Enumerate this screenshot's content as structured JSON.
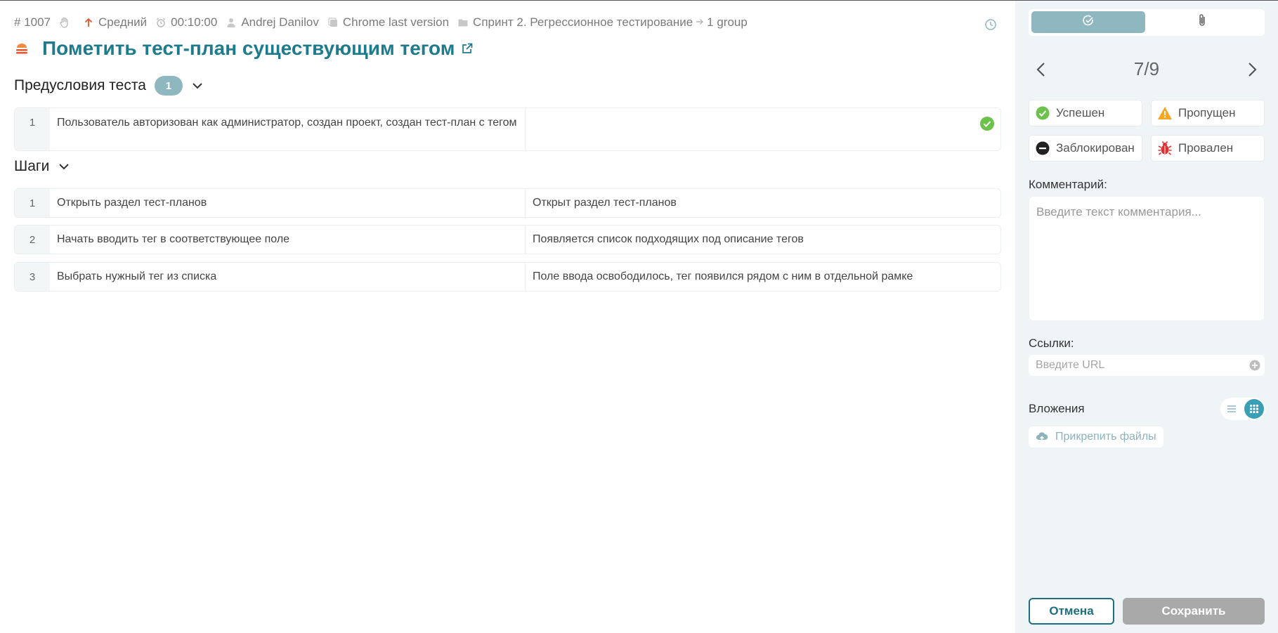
{
  "meta": {
    "id": "# 1007",
    "priority": "Средний",
    "estimate": "00:10:00",
    "assignee": "Andrej Danilov",
    "environment": "Chrome last version",
    "suite": "Спринт 2. Регрессионное тестирование",
    "group": "1 group"
  },
  "title": "Пометить тест-план существующим тегом",
  "preconditions": {
    "label": "Предусловия теста",
    "count": "1",
    "items": [
      {
        "num": "1",
        "text": "Пользователь авторизован как администратор, создан проект, создан тест-план с тегом",
        "result": ""
      }
    ]
  },
  "steps": {
    "label": "Шаги",
    "items": [
      {
        "num": "1",
        "action": "Открыть раздел тест-планов",
        "expected": "Открыт раздел тест-планов"
      },
      {
        "num": "2",
        "action": "Начать вводить тег в соответствующее поле",
        "expected": "Появляется список подходящих под описание тегов"
      },
      {
        "num": "3",
        "action": "Выбрать нужный тег из списка",
        "expected": "Поле ввода освободилось, тег появился рядом с ним в отдельной рамке"
      }
    ]
  },
  "panel": {
    "pager": "7/9",
    "statuses": {
      "passed": "Успешен",
      "skipped": "Пропущен",
      "blocked": "Заблокирован",
      "failed": "Провален"
    },
    "comment_label": "Комментарий:",
    "comment_placeholder": "Введите текст комментария...",
    "links_label": "Ссылки:",
    "url_placeholder": "Введите URL",
    "attachments_label": "Вложения",
    "attach_button": "Прикрепить файлы",
    "cancel": "Отмена",
    "save": "Сохранить"
  },
  "colors": {
    "accent": "#1e7b8c",
    "badge": "#8fb7c0",
    "passed": "#6cc24a",
    "skipped": "#f5a623",
    "failed": "#e03030",
    "priority_up": "#e4572e"
  }
}
